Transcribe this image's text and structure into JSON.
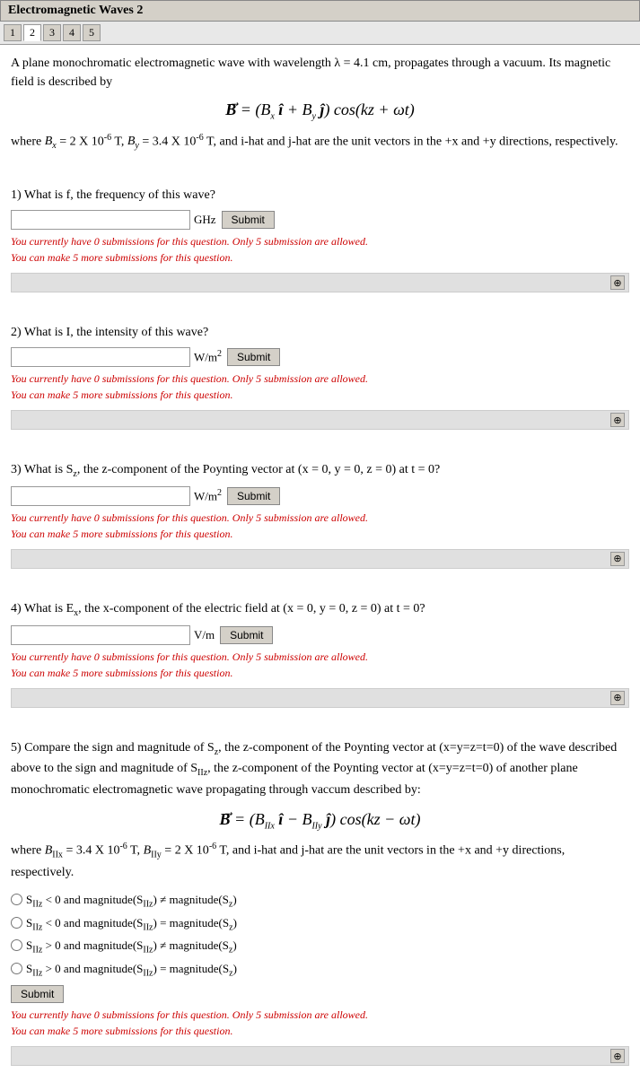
{
  "title": "Electromagnetic Waves 2",
  "tabs": [
    {
      "label": "1",
      "active": false
    },
    {
      "label": "2",
      "active": true
    },
    {
      "label": "3",
      "active": false
    },
    {
      "label": "4",
      "active": false
    },
    {
      "label": "5",
      "active": false
    }
  ],
  "intro": {
    "line1": "A plane monochromatic electromagnetic wave with wavelength λ = 4.1 cm, propagates through a vacuum. Its magnetic",
    "line2": "field is described by"
  },
  "equation1": "B⃗ = (Bₓ î + Bᵧ ĵ) cos(kz + ωt)",
  "where1": "where Bₓ = 2 X 10⁻⁶ T, Bᵧ = 3.4 X 10⁻⁶ T, and i-hat and j-hat are the unit vectors in the +x and +y directions, respectively.",
  "questions": [
    {
      "id": "q1",
      "label": "1) What is f, the frequency of this wave?",
      "unit": "GHz",
      "submit_label": "Submit",
      "submission_line1": "You currently have 0 submissions for this question. Only 5 submission are allowed.",
      "submission_line2": "You can make 5 more submissions for this question."
    },
    {
      "id": "q2",
      "label": "2) What is I, the intensity of this wave?",
      "unit": "W/m²",
      "submit_label": "Submit",
      "submission_line1": "You currently have 0 submissions for this question. Only 5 submission are allowed.",
      "submission_line2": "You can make 5 more submissions for this question."
    },
    {
      "id": "q3",
      "label": "3) What is Sz, the z-component of the Poynting vector at (x = 0, y = 0, z = 0) at t = 0?",
      "unit": "W/m²",
      "submit_label": "Submit",
      "submission_line1": "You currently have 0 submissions for this question. Only 5 submission are allowed.",
      "submission_line2": "You can make 5 more submissions for this question."
    },
    {
      "id": "q4",
      "label": "4) What is Ex, the x-component of the electric field at (x = 0, y = 0, z = 0) at t = 0?",
      "unit": "V/m",
      "submit_label": "Submit",
      "submission_line1": "You currently have 0 submissions for this question. Only 5 submission are allowed.",
      "submission_line2": "You can make 5 more submissions for this question."
    }
  ],
  "q5": {
    "label": "5) Compare the sign and magnitude of Sz, the z-component of the Poynting vector at (x=y=z=t=0) of the wave described",
    "label2": "above to the sign and magnitude of SIIz, the z-component of the Poynting vector at (x=y=z=t=0) of another plane",
    "label3": "monochromatic electromagnetic wave propagating through vaccum described by:",
    "where": "where BIIx = 3.4 X 10⁻⁶ T, BIIy = 2 X 10⁻⁶ T, and i-hat and j-hat are the unit vectors in the +x and +y directions,",
    "where2": "respectively.",
    "options": [
      "SIIz < 0 and magnitude(SIIz) ≠ magnitude(Sz)",
      "SIIz < 0 and magnitude(SIIz) = magnitude(Sz)",
      "SIIz > 0 and magnitude(SIIz) ≠ magnitude(Sz)",
      "SIIz > 0 and magnitude(SIIz) = magnitude(Sz)"
    ],
    "submit_label": "Submit",
    "submission_line1": "You currently have 0 submissions for this question. Only 5 submission are allowed.",
    "submission_line2": "You can make 5 more submissions for this question."
  },
  "plus_icon": "⊕"
}
